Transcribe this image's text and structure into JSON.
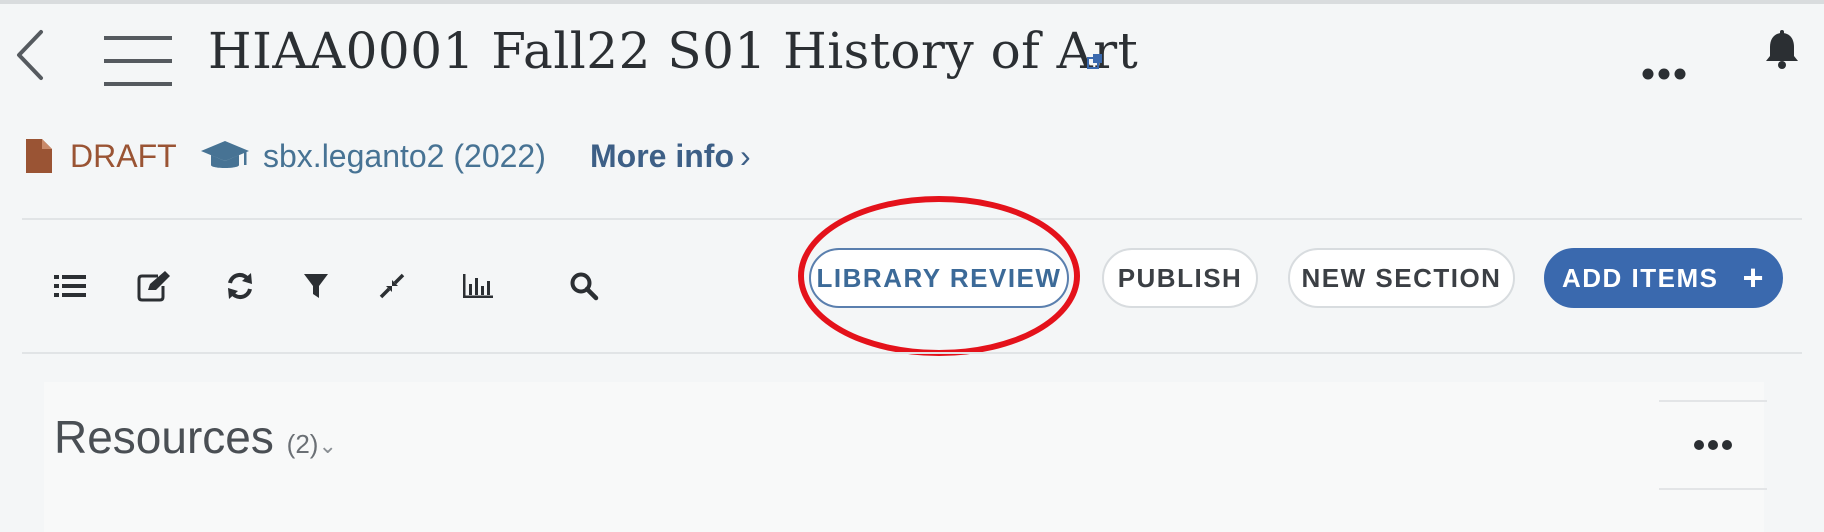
{
  "header": {
    "title": "HIAA0001 Fall22 S01 History of Art",
    "back_icon": "chevron-left-icon",
    "menu_icon": "hamburger-menu-icon",
    "more_icon": "more-horizontal-icon",
    "notifications_icon": "bell-icon"
  },
  "meta": {
    "status": "DRAFT",
    "status_icon": "document-icon",
    "campus": "sbx.leganto2 (2022)",
    "campus_icon": "graduation-cap-icon",
    "more_info": "More info",
    "more_info_chevron": "›"
  },
  "toolbar": {
    "icons": [
      "list-icon",
      "edit-icon",
      "refresh-icon",
      "filter-icon",
      "collapse-icon",
      "analytics-icon",
      "search-icon"
    ],
    "library_review": "LIBRARY REVIEW",
    "publish": "PUBLISH",
    "new_section": "NEW SECTION",
    "add_items": "ADD ITEMS",
    "add_plus": "+"
  },
  "section": {
    "title": "Resources",
    "count": "(2)",
    "chevron": "⌄"
  },
  "colors": {
    "draft": "#9a5434",
    "campus": "#477394",
    "link": "#3d5f86",
    "primary": "#3a69ae",
    "highlight": "#e4121b"
  }
}
